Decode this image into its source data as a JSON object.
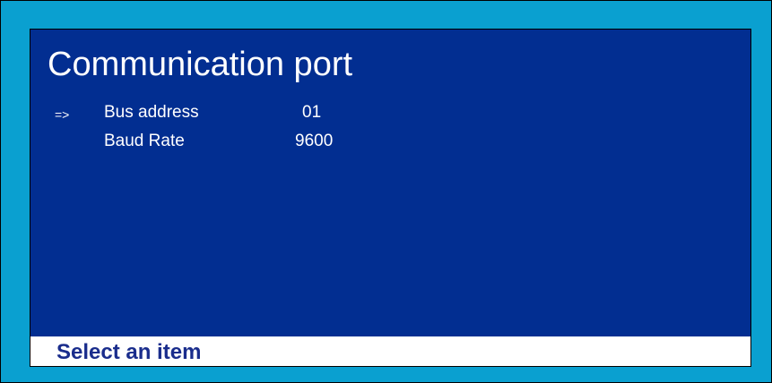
{
  "screen": {
    "title": "Communication port"
  },
  "menu": {
    "pointer": "=>",
    "items": [
      {
        "label": "Bus address",
        "value": "01",
        "selected": true
      },
      {
        "label": "Baud Rate",
        "value": "9600",
        "selected": false
      }
    ]
  },
  "status": {
    "text": "Select an item"
  },
  "colors": {
    "background": "#0aa0d0",
    "panel": "#022e91",
    "text": "#ffffff",
    "status_background": "#ffffff",
    "status_text": "#1a2d8c"
  }
}
